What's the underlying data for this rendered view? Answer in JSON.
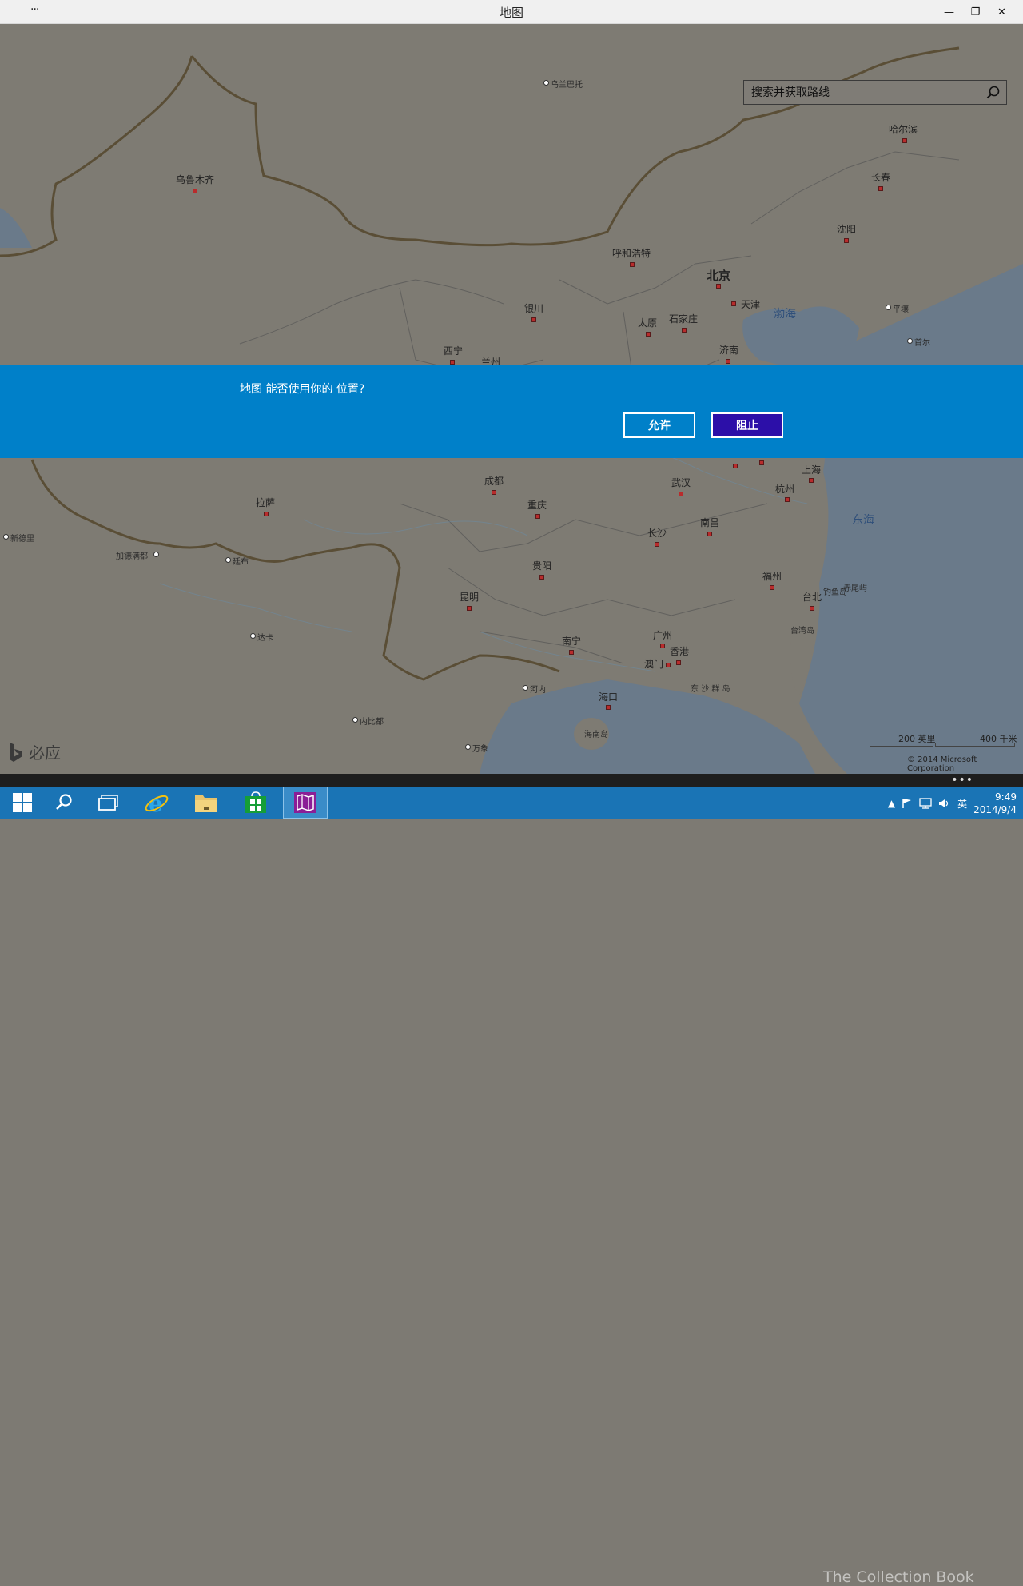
{
  "window": {
    "title": "地图",
    "menu_glyph": "···",
    "minimize": "—",
    "restore": "❐",
    "close": "✕"
  },
  "search": {
    "placeholder": "搜索并获取路线",
    "value": ""
  },
  "map": {
    "cities": [
      {
        "name": "乌兰巴托"
      },
      {
        "name": "乌鲁木齐"
      },
      {
        "name": "哈尔滨"
      },
      {
        "name": "长春"
      },
      {
        "name": "沈阳"
      },
      {
        "name": "呼和浩特"
      },
      {
        "name": "北京"
      },
      {
        "name": "天津"
      },
      {
        "name": "平壤"
      },
      {
        "name": "首尔"
      },
      {
        "name": "银川"
      },
      {
        "name": "太原"
      },
      {
        "name": "石家庄"
      },
      {
        "name": "西宁"
      },
      {
        "name": "兰州"
      },
      {
        "name": "济南"
      },
      {
        "name": "成都"
      },
      {
        "name": "上海"
      },
      {
        "name": "武汉"
      },
      {
        "name": "杭州"
      },
      {
        "name": "拉萨"
      },
      {
        "name": "重庆"
      },
      {
        "name": "新德里"
      },
      {
        "name": "长沙"
      },
      {
        "name": "南昌"
      },
      {
        "name": "加德满都"
      },
      {
        "name": "廷布"
      },
      {
        "name": "贵阳"
      },
      {
        "name": "福州"
      },
      {
        "name": "台北"
      },
      {
        "name": "昆明"
      },
      {
        "name": "达卡"
      },
      {
        "name": "广州"
      },
      {
        "name": "南宁"
      },
      {
        "name": "香港"
      },
      {
        "name": "澳门"
      },
      {
        "name": "河内"
      },
      {
        "name": "海口"
      },
      {
        "name": "内比都"
      },
      {
        "name": "万象"
      }
    ],
    "labels": {
      "bohai": "渤海",
      "donghai": "东海",
      "diaoyu": "钓鱼岛",
      "chiwei": "赤尾屿",
      "taiwan": "台湾岛",
      "dongsha": "东 沙 群 岛",
      "hainan": "海南岛"
    },
    "scale_miles": "200 英里",
    "scale_km": "400 千米",
    "copyright": "© 2014 Microsoft Corporation",
    "brand": "必应"
  },
  "prompt": {
    "message": "地图 能否使用你的 位置?",
    "allow": "允许",
    "block": "阻止",
    "bg_color": "#0080c9",
    "block_color": "#2c0fa8"
  },
  "appbar": {
    "more": "•••"
  },
  "taskbar": {
    "clock_time": "9:49",
    "clock_date": "2014/9/4",
    "ime": "英",
    "watermark": "The Collection Book"
  }
}
